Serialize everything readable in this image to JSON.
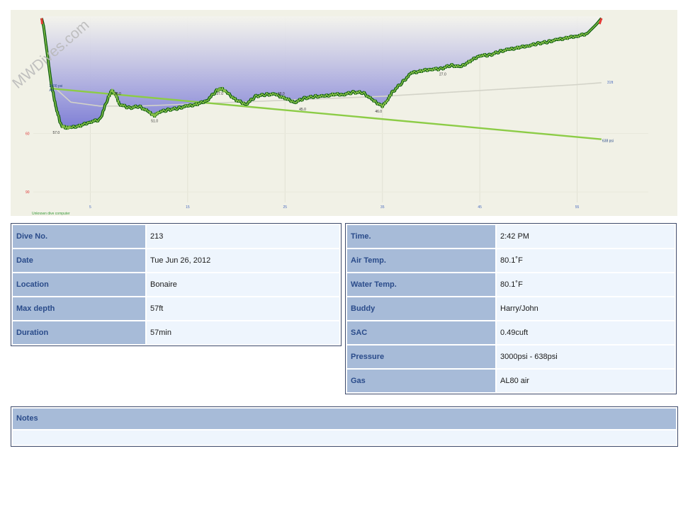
{
  "profile": {
    "watermark": "MWDives.com",
    "computer_label": "Unknown dive computer",
    "colors": {
      "background": "#f1f1e6",
      "depth_fill_top": "#7f7fd6",
      "profile_dark": "#0f5e12",
      "profile_light": "#8bc34a",
      "pressure_line": "#8ccc46",
      "mean_depth_line": "#d3d3c8",
      "ascent_warning": "#e53935"
    }
  },
  "chart_data": {
    "type": "line",
    "xlabel": "",
    "ylabel": "",
    "xlim": [
      -1,
      61
    ],
    "ylim": [
      99,
      0
    ],
    "x_ticks": [
      "5",
      "15",
      "25",
      "35",
      "45",
      "55"
    ],
    "x_tick_values": [
      5,
      15,
      25,
      35,
      45,
      55
    ],
    "y_ticks": [
      "60",
      "90"
    ],
    "y_tick_values": [
      60,
      90
    ],
    "depth_series": {
      "name": "Depth",
      "x": [
        0,
        0.2,
        0.6,
        1,
        1.5,
        2,
        2.5,
        3,
        4,
        5,
        6,
        6.8,
        7.2,
        7.6,
        8,
        9,
        10,
        11,
        11.6,
        12,
        13,
        14,
        15,
        16,
        17,
        18,
        18.5,
        19,
        20,
        21,
        22,
        23,
        24,
        25,
        26,
        27,
        28,
        29,
        30,
        31,
        32,
        33,
        34,
        35,
        35.5,
        36,
        37,
        38,
        39,
        40,
        41,
        42,
        43,
        44,
        45,
        46,
        47,
        48,
        49,
        50,
        51,
        52,
        53,
        54,
        55,
        56,
        57,
        57.5
      ],
      "y": [
        1,
        5,
        20,
        35,
        47,
        56,
        57,
        57,
        56,
        54,
        53,
        42,
        38,
        40,
        45,
        47,
        46,
        49,
        51,
        49,
        48,
        47,
        46,
        45,
        43,
        38,
        37,
        39,
        43,
        45,
        41,
        40,
        40,
        42,
        44,
        42,
        41,
        41,
        40,
        40,
        39,
        39,
        43,
        46,
        43,
        39,
        34,
        29,
        28,
        27,
        27,
        25,
        26,
        23,
        20,
        20,
        18,
        17,
        16,
        15,
        14,
        13,
        12,
        11,
        10,
        9,
        4,
        1
      ]
    },
    "mean_depth_series": {
      "name": "",
      "end_label": "31ft",
      "x": [
        1,
        3,
        6,
        10,
        15,
        20,
        25,
        30,
        35,
        40,
        45,
        50,
        55,
        57.5
      ],
      "y": [
        35,
        44,
        46,
        46,
        45,
        44,
        43,
        42,
        41,
        39.5,
        38,
        36.5,
        35,
        34
      ]
    },
    "pressure_series": {
      "name": "",
      "start_label": "3000 psi",
      "start_sub_label": "Air",
      "end_label": "638 psi",
      "x": [
        1,
        57.5
      ],
      "y": [
        37,
        63
      ]
    },
    "depth_labels": [
      {
        "x": 1.5,
        "y": 57,
        "text": "57.0"
      },
      {
        "x": 7.8,
        "y": 37,
        "text": "38.0"
      },
      {
        "x": 11.6,
        "y": 51,
        "text": "51.0"
      },
      {
        "x": 18.3,
        "y": 37,
        "text": "37.0"
      },
      {
        "x": 24.6,
        "y": 37,
        "text": "38.0"
      },
      {
        "x": 26.8,
        "y": 45,
        "text": "45.0"
      },
      {
        "x": 34.6,
        "y": 46,
        "text": "46.0"
      },
      {
        "x": 41.2,
        "y": 27,
        "text": "27.0"
      }
    ]
  },
  "details": {
    "left": [
      {
        "label": "Dive No.",
        "value": "213"
      },
      {
        "label": "Date",
        "value": "Tue Jun 26, 2012"
      },
      {
        "label": "Location",
        "value": "Bonaire"
      },
      {
        "label": "Max depth",
        "value": "57ft"
      },
      {
        "label": "Duration",
        "value": "57min"
      }
    ],
    "right": [
      {
        "label": "Time.",
        "value": "2:42 PM"
      },
      {
        "label": "Air Temp.",
        "value": "80.1˚F"
      },
      {
        "label": "Water Temp.",
        "value": "80.1˚F"
      },
      {
        "label": "Buddy",
        "value": "Harry/John"
      },
      {
        "label": "SAC",
        "value": "0.49cuft"
      },
      {
        "label": "Pressure",
        "value": "3000psi - 638psi"
      },
      {
        "label": "Gas",
        "value": "AL80 air"
      }
    ]
  },
  "notes": {
    "label": "Notes",
    "value": ""
  }
}
